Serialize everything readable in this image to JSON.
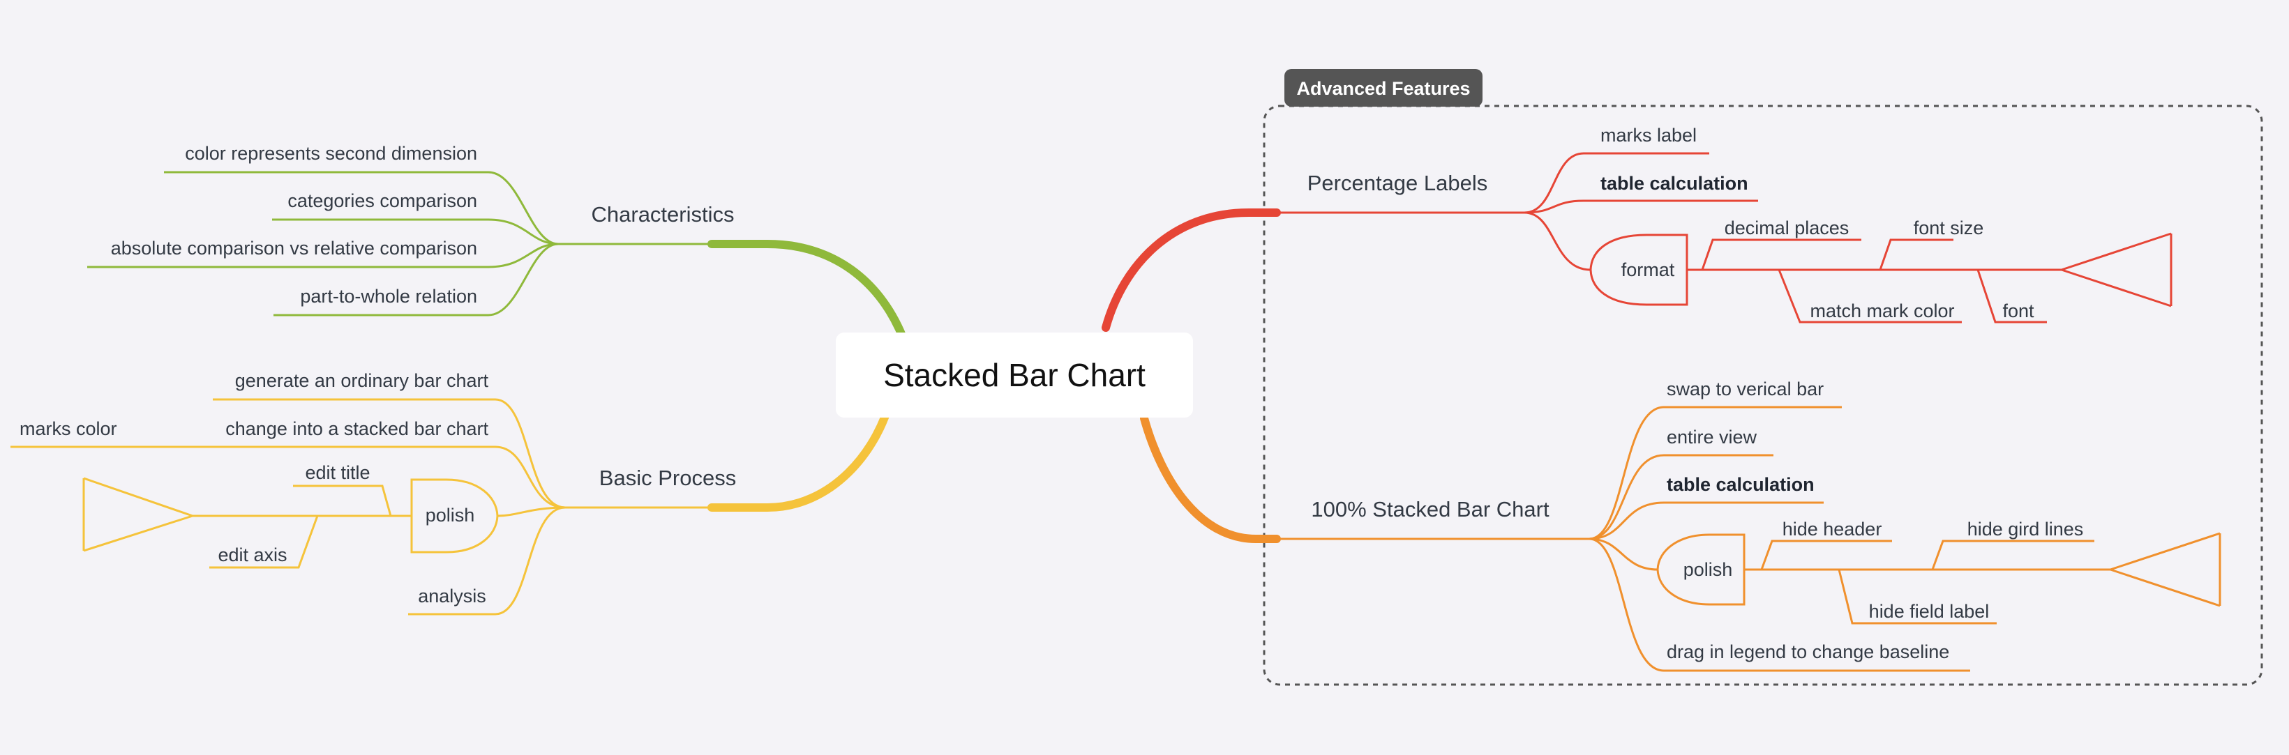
{
  "central": "Stacked Bar Chart",
  "colors": {
    "characteristics": "#8fb93b",
    "basic_process": "#f5c33b",
    "percentage": "#e64536",
    "stacked100": "#f0902d",
    "background": "#f4f3f7",
    "tag": "#555555"
  },
  "characteristics": {
    "label": "Characteristics",
    "items": [
      "color represents second dimension",
      "categories comparison",
      "absolute comparison vs relative comparison",
      "part-to-whole relation"
    ]
  },
  "basic_process": {
    "label": "Basic Process",
    "generate": "generate an ordinary bar chart",
    "change": "change into a stacked bar chart",
    "marks_color": "marks color",
    "polish": "polish",
    "edit_title": "edit title",
    "edit_axis": "edit axis",
    "analysis": "analysis"
  },
  "advanced": {
    "tag": "Advanced Features",
    "percentage": {
      "label": "Percentage Labels",
      "marks_label": "marks label",
      "table_calc": "table calculation",
      "format": "format",
      "decimal_places": "decimal places",
      "font_size": "font size",
      "match_mark_color": "match mark color",
      "font": "font"
    },
    "stacked100": {
      "label": "100% Stacked Bar Chart",
      "swap": "swap to verical bar",
      "entire_view": "entire view",
      "table_calc": "table calculation",
      "polish": "polish",
      "hide_header": "hide header",
      "hide_grid": "hide gird lines",
      "hide_field": "hide field label",
      "drag": "drag in legend to change baseline"
    }
  }
}
